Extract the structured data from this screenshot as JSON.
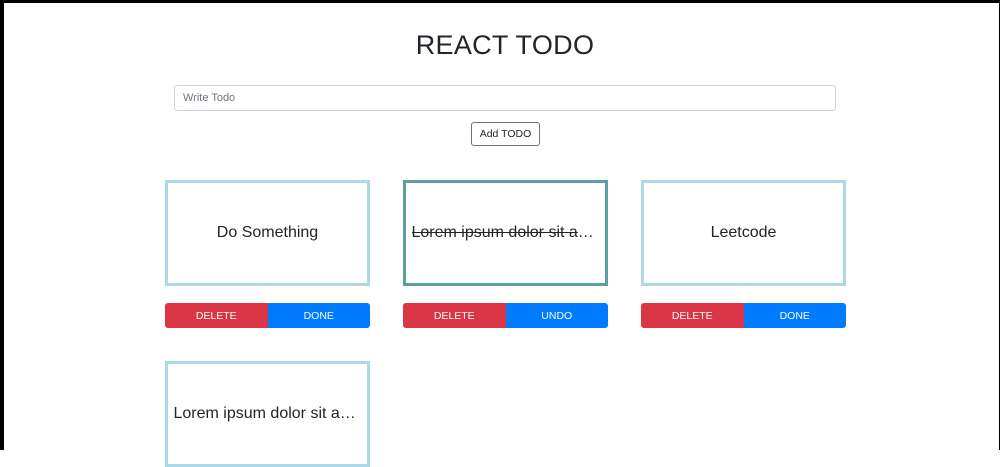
{
  "header": {
    "title": "REACT TODO"
  },
  "input": {
    "placeholder": "Write Todo",
    "value": ""
  },
  "add_button": {
    "label": "Add TODO"
  },
  "todos": [
    {
      "text": "Do Something",
      "completed": false,
      "delete_label": "DELETE",
      "toggle_label": "DONE"
    },
    {
      "text": "Lorem ipsum dolor sit amet",
      "completed": true,
      "delete_label": "DELETE",
      "toggle_label": "UNDO"
    },
    {
      "text": "Leetcode",
      "completed": false,
      "delete_label": "DELETE",
      "toggle_label": "DONE"
    },
    {
      "text": "Lorem ipsum dolor sit amet",
      "completed": false
    }
  ],
  "colors": {
    "card_border": "#add8e6",
    "card_border_done": "#5f9ea0",
    "delete": "#dc3545",
    "done": "#007bff"
  }
}
